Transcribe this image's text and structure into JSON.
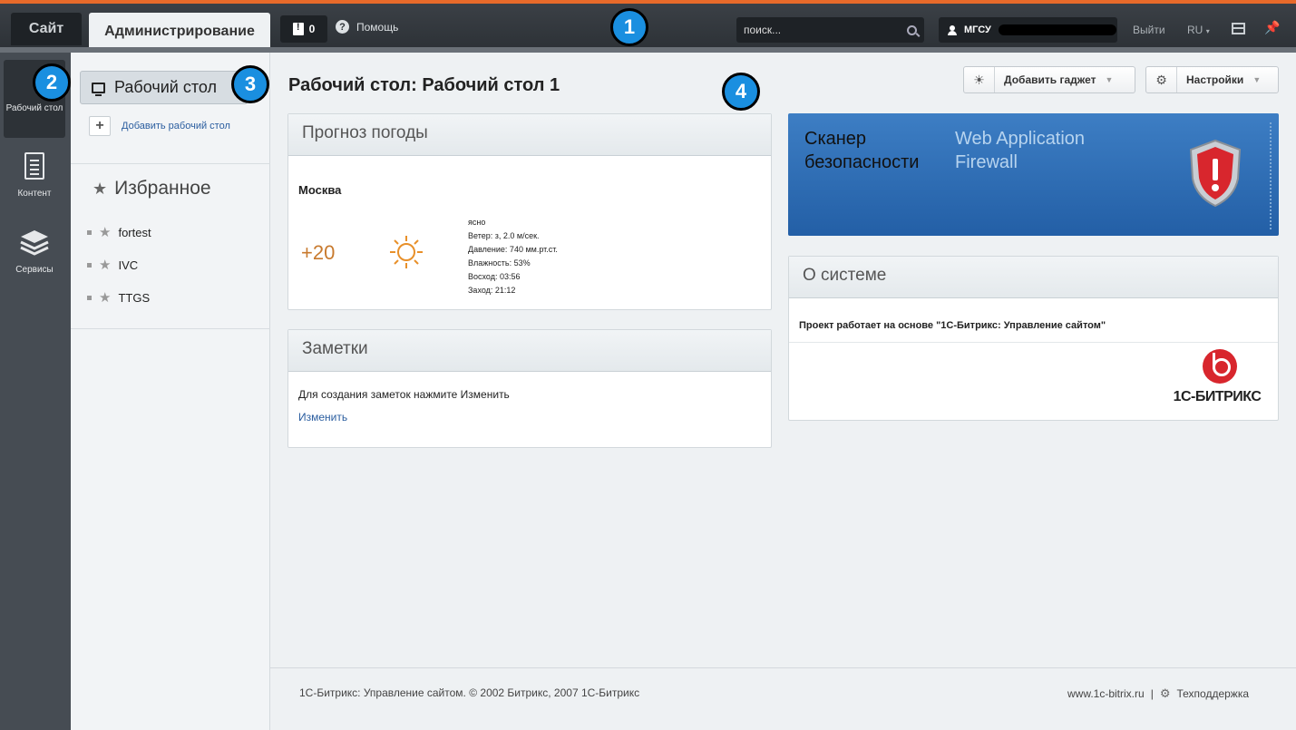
{
  "topbar": {
    "tab_site": "Сайт",
    "tab_admin": "Администрирование",
    "notifications_count": "0",
    "help_label": "Помощь",
    "search_placeholder": "поиск...",
    "user_name": "МГСУ",
    "logout_label": "Выйти",
    "language": "RU",
    "accent_color": "#e86a2a"
  },
  "leftmenu": {
    "items": [
      {
        "label": "Рабочий стол",
        "icon": "desktop-icon",
        "active": true
      },
      {
        "label": "Контент",
        "icon": "document-icon"
      },
      {
        "label": "Сервисы",
        "icon": "layers-icon"
      }
    ]
  },
  "second": {
    "desktop_button": "Рабочий стол",
    "add_desktop": "Добавить рабочий стол",
    "favorites_title": "Избранное",
    "favorites": [
      "fortest",
      "IVC",
      "TTGS"
    ]
  },
  "main": {
    "page_title": "Рабочий стол: Рабочий стол 1",
    "add_gadget": "Добавить гаджет",
    "settings": "Настройки"
  },
  "weather": {
    "title": "Прогноз погоды",
    "city": "Москва",
    "temperature": "+20",
    "condition": "ясно",
    "wind": "Ветер: з, 2.0 м/сек.",
    "pressure": "Давление: 740 мм.рт.ст.",
    "humidity": "Влажность: 53%",
    "sunrise": "Восход: 03:56",
    "sunset": "Заход: 21:12"
  },
  "notes": {
    "title": "Заметки",
    "text": "Для создания заметок нажмите Изменить",
    "edit_link": "Изменить"
  },
  "scanner": {
    "left": "Сканер безопасности",
    "right": "Web Application Firewall"
  },
  "about": {
    "title": "О системе",
    "text": "Проект работает на основе \"1С-Битрикс: Управление сайтом\"",
    "logo_text": "1С-БИТРИКС"
  },
  "footer": {
    "copyright": "1С-Битрикс: Управление сайтом. © 2002 Битрикс, 2007 1С-Битрикс",
    "site_link": "www.1c-bitrix.ru",
    "separator": "|",
    "support": "Техподдержка"
  },
  "markers": [
    "1",
    "2",
    "3",
    "4"
  ]
}
